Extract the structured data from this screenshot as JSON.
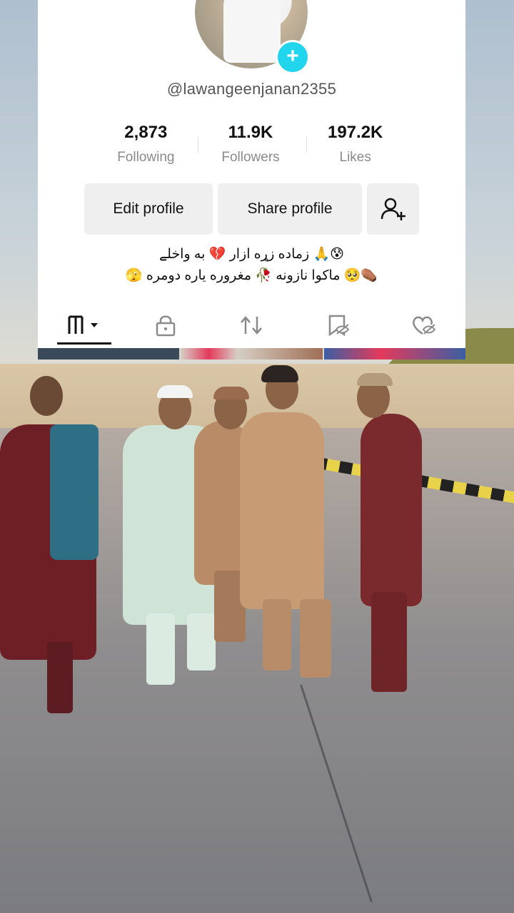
{
  "profile": {
    "username": "@lawangeenjanan2355",
    "add_icon": "plus-icon"
  },
  "stats": [
    {
      "value": "2,873",
      "label": "Following"
    },
    {
      "value": "11.9K",
      "label": "Followers"
    },
    {
      "value": "197.2K",
      "label": "Likes"
    }
  ],
  "buttons": {
    "edit_profile": "Edit profile",
    "share_profile": "Share profile",
    "add_friend_icon": "person-add-icon"
  },
  "bio": {
    "line1": "😰🙏 زماده زړه ازار 💔 به واخلے",
    "line2": "⚰️🥺 ماکوا نازونه 🥀 مغروره یاره دومره 🫣"
  },
  "tabs": [
    {
      "icon": "videos-grid-icon"
    },
    {
      "icon": "lock-icon"
    },
    {
      "icon": "repost-icon"
    },
    {
      "icon": "favorites-hidden-icon"
    },
    {
      "icon": "liked-hidden-icon"
    }
  ],
  "colors": {
    "accent": "#20d5ec",
    "button_bg": "#efefef",
    "card_bg": "#ffffff"
  }
}
